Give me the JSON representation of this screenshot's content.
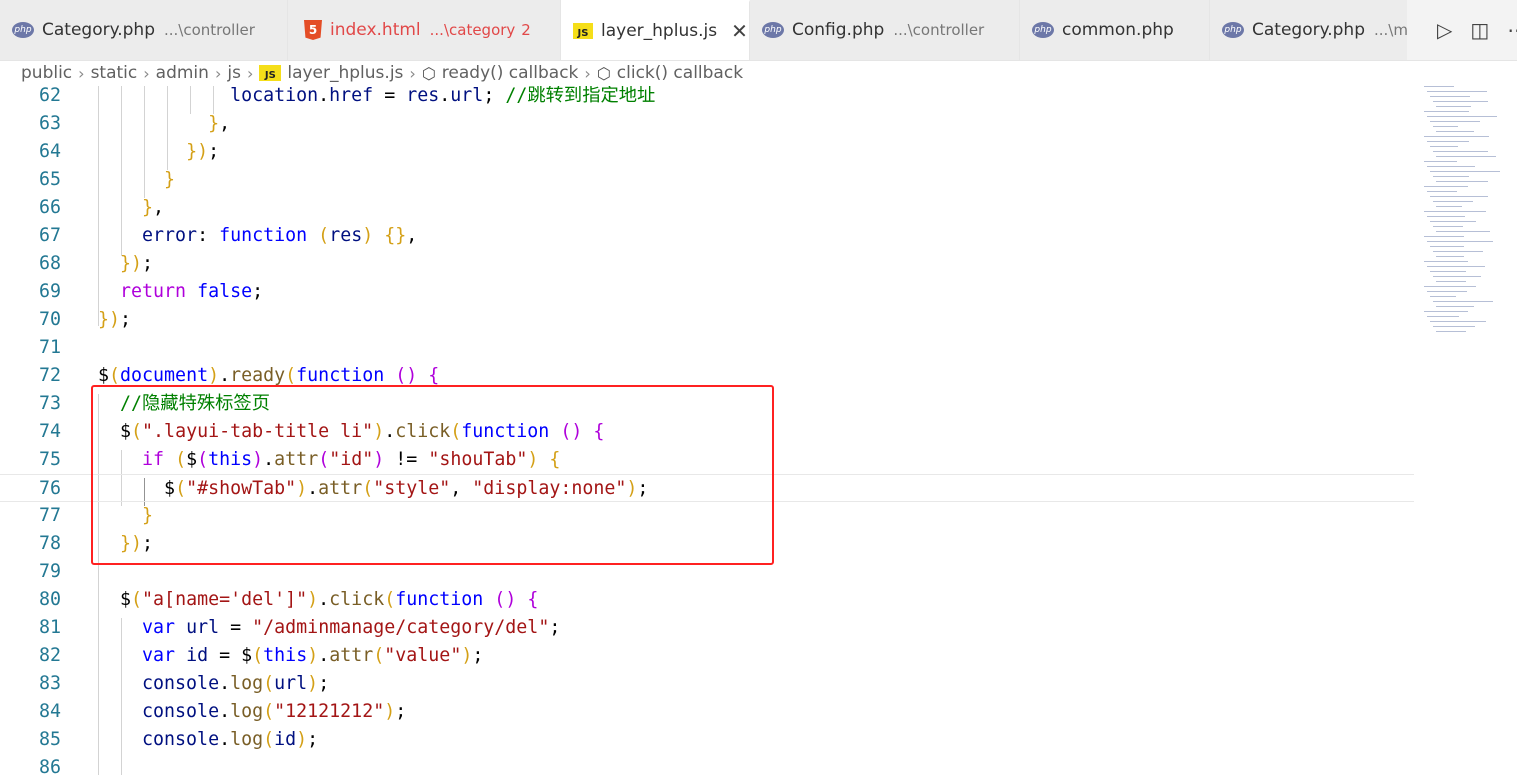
{
  "tabs": [
    {
      "icon": "php",
      "name": "Category.php",
      "desc": "...\\controller",
      "active": false,
      "error": false
    },
    {
      "icon": "html",
      "name": "index.html",
      "desc": "...\\category",
      "count": "2",
      "active": false,
      "error": true
    },
    {
      "icon": "js",
      "name": "layer_hplus.js",
      "desc": "",
      "active": true,
      "error": false
    },
    {
      "icon": "php",
      "name": "Config.php",
      "desc": "...\\controller",
      "active": false,
      "error": false
    },
    {
      "icon": "php",
      "name": "common.php",
      "desc": "",
      "active": false,
      "error": false
    },
    {
      "icon": "php",
      "name": "Category.php",
      "desc": "...\\mode",
      "active": false,
      "error": false
    }
  ],
  "icons": {
    "php": "php",
    "html": "5",
    "js": "JS",
    "close": "✕",
    "run": "▷",
    "split": "◫",
    "more": "⋯"
  },
  "breadcrumb": {
    "parts": [
      "public",
      "static",
      "admin",
      "js"
    ],
    "file": "layer_hplus.js",
    "symbols": [
      "ready() callback",
      "click() callback"
    ]
  },
  "code_lines": [
    {
      "n": "62",
      "text": "            location.href = res.url; //跳转到指定地址"
    },
    {
      "n": "63",
      "text": "          },"
    },
    {
      "n": "64",
      "text": "        });"
    },
    {
      "n": "65",
      "text": "      }"
    },
    {
      "n": "66",
      "text": "    },"
    },
    {
      "n": "67",
      "text": "    error: function (res) {},"
    },
    {
      "n": "68",
      "text": "  });"
    },
    {
      "n": "69",
      "text": "  return false;"
    },
    {
      "n": "70",
      "text": "});"
    },
    {
      "n": "71",
      "text": ""
    },
    {
      "n": "72",
      "text": "$(document).ready(function () {"
    },
    {
      "n": "73",
      "text": "  //隐藏特殊标签页"
    },
    {
      "n": "74",
      "text": "  $(\".layui-tab-title li\").click(function () {"
    },
    {
      "n": "75",
      "text": "    if ($(this).attr(\"id\") != \"shouTab\") {"
    },
    {
      "n": "76",
      "text": "      $(\"#showTab\").attr(\"style\", \"display:none\");"
    },
    {
      "n": "77",
      "text": "    }"
    },
    {
      "n": "78",
      "text": "  });"
    },
    {
      "n": "79",
      "text": ""
    },
    {
      "n": "80",
      "text": "  $(\"a[name='del']\").click(function () {"
    },
    {
      "n": "81",
      "text": "    var url = \"/adminmanage/category/del\";"
    },
    {
      "n": "82",
      "text": "    var id = $(this).attr(\"value\");"
    },
    {
      "n": "83",
      "text": "    console.log(url);"
    },
    {
      "n": "84",
      "text": "    console.log(\"12121212\");"
    },
    {
      "n": "85",
      "text": "    console.log(id);"
    },
    {
      "n": "86",
      "text": ""
    }
  ],
  "active_line": "76",
  "colors": {
    "keyword": "#0000ff",
    "control": "#af00db",
    "string": "#a31515",
    "comment": "#008000",
    "function": "#795e26",
    "variable": "#001080",
    "line_number": "#237893",
    "highlight_border": "#ff2121"
  }
}
